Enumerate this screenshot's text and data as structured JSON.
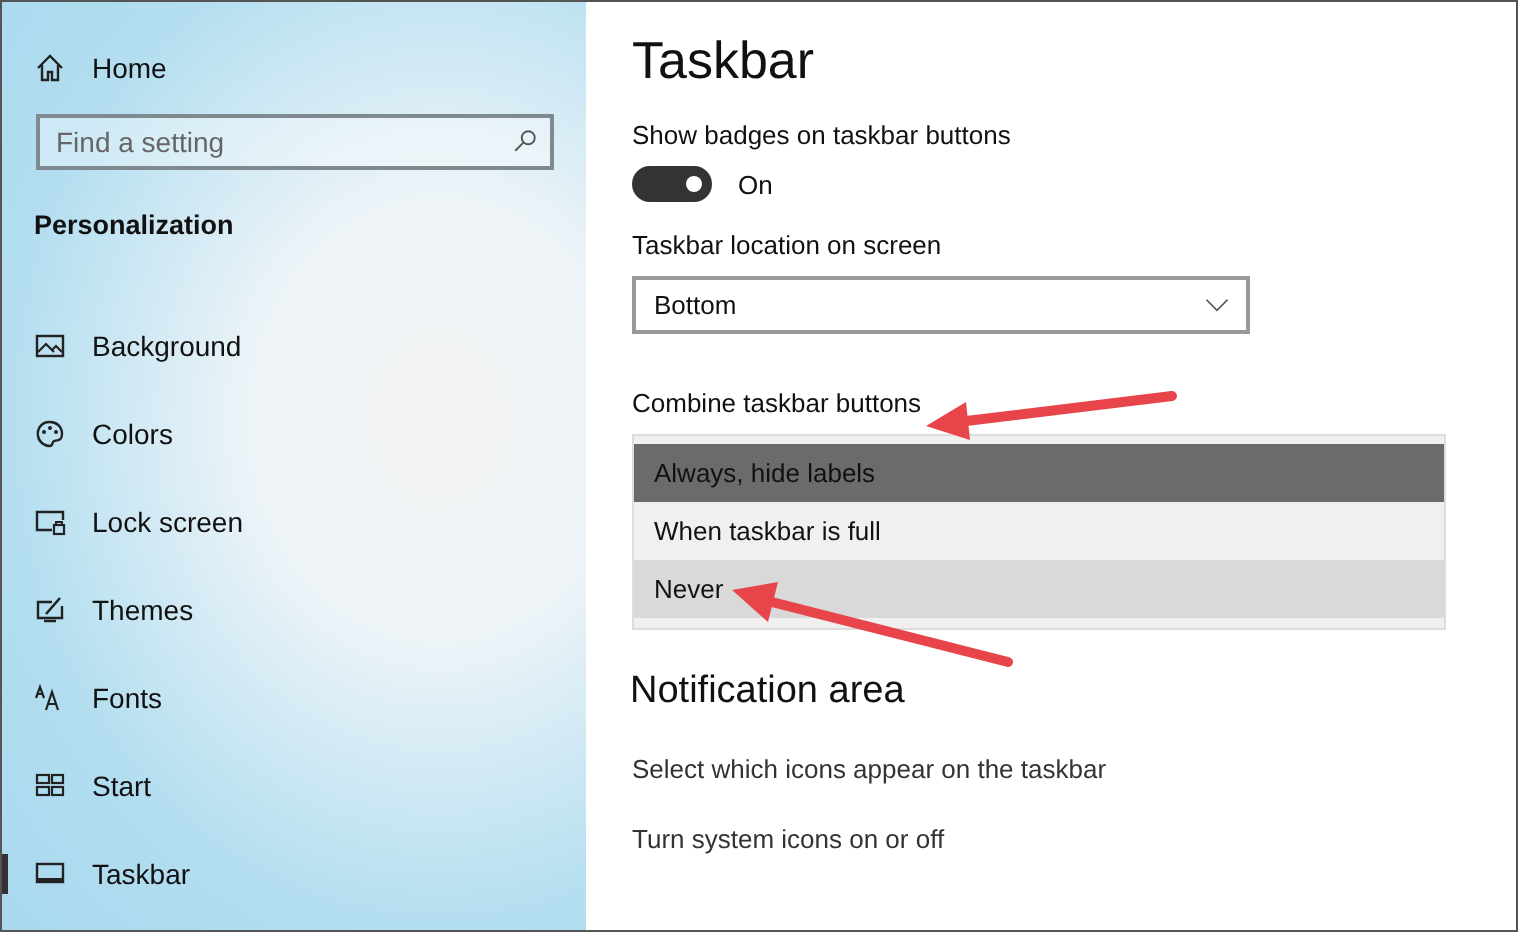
{
  "sidebar": {
    "home": "Home",
    "search": {
      "placeholder": "Find a setting"
    },
    "section": "Personalization",
    "items": [
      {
        "label": "Background",
        "selected": false
      },
      {
        "label": "Colors",
        "selected": false
      },
      {
        "label": "Lock screen",
        "selected": false
      },
      {
        "label": "Themes",
        "selected": false
      },
      {
        "label": "Fonts",
        "selected": false
      },
      {
        "label": "Start",
        "selected": false
      },
      {
        "label": "Taskbar",
        "selected": true
      }
    ]
  },
  "main": {
    "title": "Taskbar",
    "badges": {
      "label": "Show badges on taskbar buttons",
      "on": true,
      "state": "On"
    },
    "location": {
      "label": "Taskbar location on screen",
      "value": "Bottom"
    },
    "combine": {
      "label": "Combine taskbar buttons",
      "options": [
        {
          "label": "Always, hide labels",
          "selected": true,
          "hovered": false
        },
        {
          "label": "When taskbar is full",
          "selected": false,
          "hovered": false
        },
        {
          "label": "Never",
          "selected": false,
          "hovered": true
        }
      ]
    },
    "notification": {
      "title": "Notification area",
      "links": [
        "Select which icons appear on the taskbar",
        "Turn system icons on or off"
      ]
    }
  }
}
